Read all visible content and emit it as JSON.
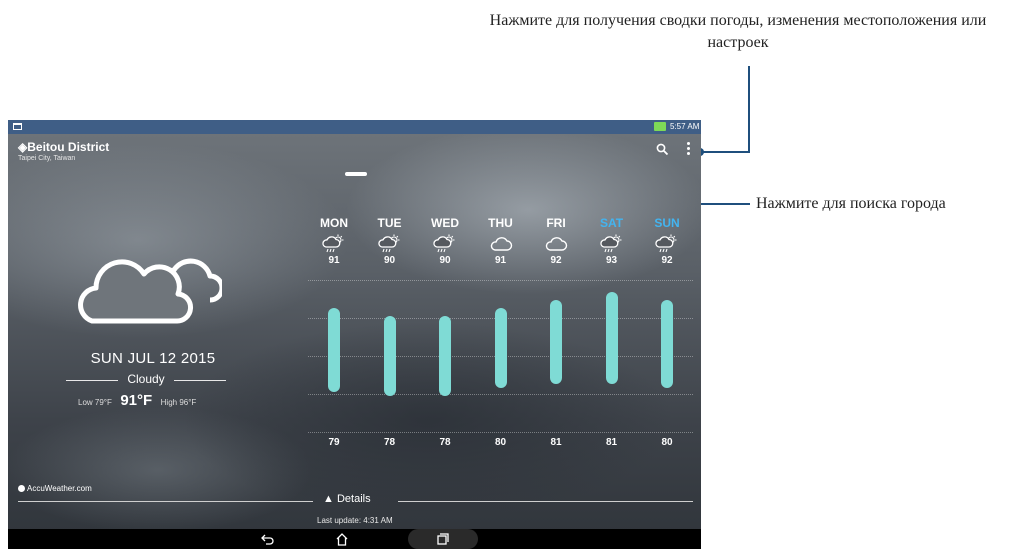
{
  "annotations": {
    "menu_hint": "Нажмите для получения сводки погоды, изменения местоположения или настроек",
    "search_hint": "Нажмите для поиска города"
  },
  "statusbar": {
    "time": "5:57 AM"
  },
  "location": {
    "name": "Beitou District",
    "region": "Taipei City, Taiwan"
  },
  "current": {
    "date": "SUN JUL 12 2015",
    "condition": "Cloudy",
    "low_label": "Low 79°F",
    "temp": "91°F",
    "high_label": "High 96°F",
    "icon": "cloud-icon"
  },
  "provider": "AccuWeather.com",
  "forecast": [
    {
      "day": "MON",
      "icon": "rain-sun-icon",
      "high": "91",
      "low": "79",
      "weekend": false
    },
    {
      "day": "TUE",
      "icon": "rain-sun-icon",
      "high": "90",
      "low": "78",
      "weekend": false
    },
    {
      "day": "WED",
      "icon": "rain-sun-icon",
      "high": "90",
      "low": "78",
      "weekend": false
    },
    {
      "day": "THU",
      "icon": "cloud-icon",
      "high": "91",
      "low": "80",
      "weekend": false
    },
    {
      "day": "FRI",
      "icon": "cloud-icon",
      "high": "92",
      "low": "81",
      "weekend": false
    },
    {
      "day": "SAT",
      "icon": "rain-sun-icon",
      "high": "93",
      "low": "81",
      "weekend": true
    },
    {
      "day": "SUN",
      "icon": "rain-sun-icon",
      "high": "92",
      "low": "80",
      "weekend": true
    }
  ],
  "details": {
    "label": "Details",
    "last_update": "Last update: 4:31 AM"
  },
  "colors": {
    "weekend": "#43b4f0",
    "bar": "#7fdbd5",
    "annotation_line": "#1f4f7d",
    "statusbar": "#3f5e86"
  }
}
